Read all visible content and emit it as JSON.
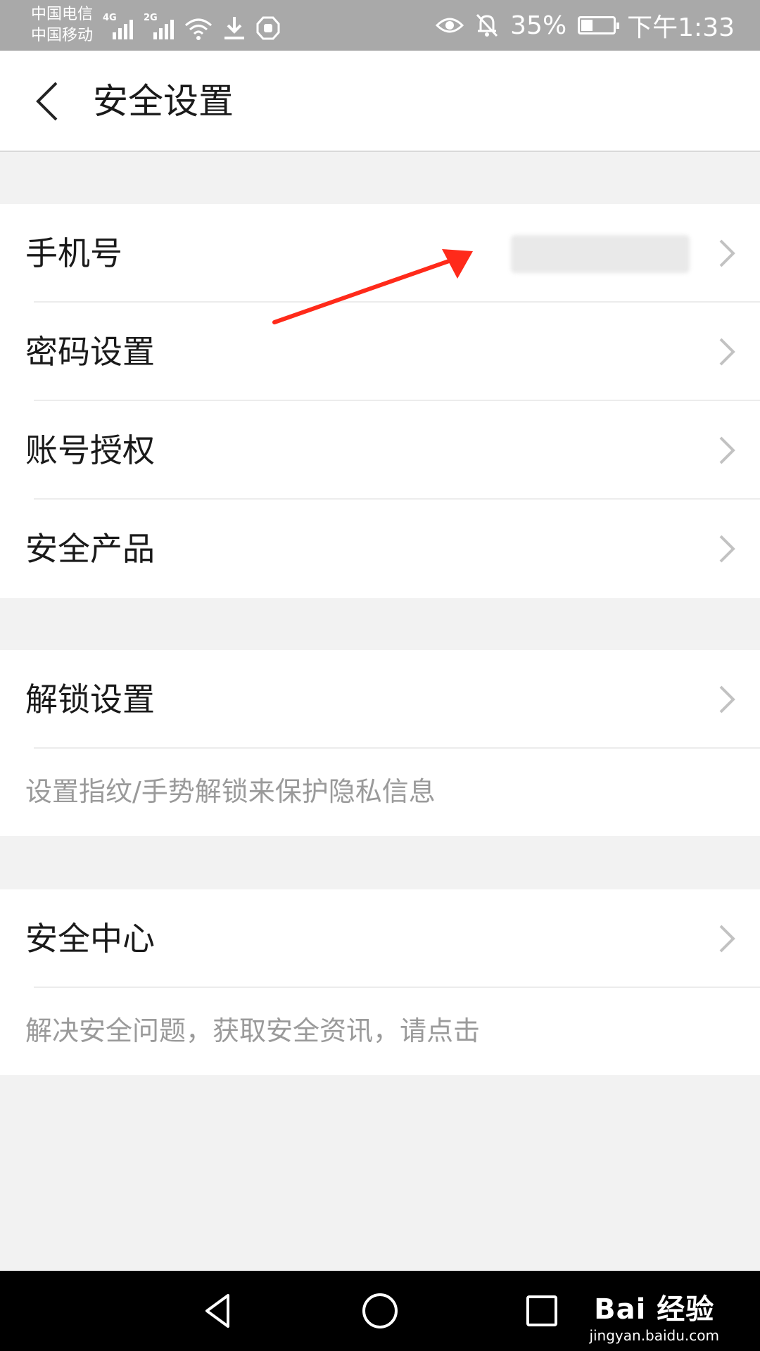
{
  "status_bar": {
    "carrier_1": "中国电信",
    "carrier_2": "中国移动",
    "sig1_tag": "4G",
    "sig2_tag": "2G",
    "battery": "35%",
    "time": "下午1:33"
  },
  "header": {
    "title": "安全设置"
  },
  "group1": {
    "items": [
      {
        "label": "手机号"
      },
      {
        "label": "密码设置"
      },
      {
        "label": "账号授权"
      },
      {
        "label": "安全产品"
      }
    ]
  },
  "group2": {
    "label": "解锁设置",
    "desc": "设置指纹/手势解锁来保护隐私信息"
  },
  "group3": {
    "label": "安全中心",
    "desc": "解决安全问题，获取安全资讯，请点击"
  },
  "watermark": {
    "logo": "Bai 经验",
    "url": "jingyan.baidu.com"
  },
  "colors": {
    "annotation_arrow": "#ff2a1a",
    "status_bar_bg": "#a9a9a9"
  }
}
